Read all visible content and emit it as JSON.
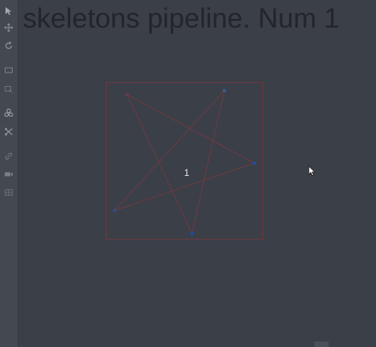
{
  "canvas": {
    "title": "skeletons pipeline. Num 1",
    "skeleton_label": "1",
    "colors": {
      "background": "#3b3f48",
      "edge": "#6e3a40",
      "bbox": "#6a3a3f",
      "keypoint": "#2f4e86"
    }
  },
  "toolbar": {
    "tools": [
      {
        "name": "cursor-tool",
        "icon": "cursor-icon"
      },
      {
        "name": "move-tool",
        "icon": "move-icon"
      },
      {
        "name": "rotate-tool",
        "icon": "rotate-icon"
      },
      {
        "name": "fit-tool",
        "icon": "fit-icon"
      },
      {
        "name": "zoom-tool",
        "icon": "zoom-icon"
      },
      {
        "name": "group-tool",
        "icon": "group-icon"
      },
      {
        "name": "split-tool",
        "icon": "split-icon"
      },
      {
        "name": "link-tool",
        "icon": "link-icon"
      },
      {
        "name": "camera-tool",
        "icon": "camera-icon"
      },
      {
        "name": "grid-tool",
        "icon": "grid-icon"
      }
    ]
  }
}
